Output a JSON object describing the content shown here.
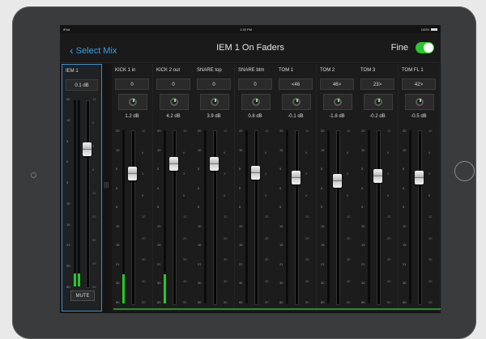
{
  "statusbar": {
    "left": "iPad",
    "time": "1:15 PM",
    "right": "100%"
  },
  "nav": {
    "back_label": "Select Mix",
    "title": "IEM 1 On Faders",
    "fine_label": "Fine",
    "fine_on": true
  },
  "scale_left": [
    "20",
    "10",
    "5",
    "0",
    "5",
    "10",
    "15",
    "21",
    "30",
    "60"
  ],
  "scale_right": [
    "12",
    "6",
    "3",
    "6",
    "12",
    "20",
    "30",
    "40",
    "50"
  ],
  "main_strip": {
    "name": "IEM 1",
    "level": "0.1 dB",
    "mute_label": "MUTE",
    "meter_level": 0.07
  },
  "channels": [
    {
      "name": "KICK 1 in",
      "pan": "0",
      "gain": "1.2 dB",
      "meter_level": 0.17
    },
    {
      "name": "KICK 2 out",
      "pan": "0",
      "gain": "4.2 dB",
      "meter_level": 0.17
    },
    {
      "name": "SNARE top",
      "pan": "0",
      "gain": "3.9 dB",
      "meter_level": 0
    },
    {
      "name": "SNARE btm",
      "pan": "0",
      "gain": "0.8 dB",
      "meter_level": 0
    },
    {
      "name": "TOM 1",
      "pan": "<46",
      "gain": "-0.1 dB",
      "meter_level": 0
    },
    {
      "name": "TOM 2",
      "pan": "46>",
      "gain": "-1.8 dB",
      "meter_level": 0
    },
    {
      "name": "TOM 3",
      "pan": "23>",
      "gain": "-0.2 dB",
      "meter_level": 0
    },
    {
      "name": "TOM FL 1",
      "pan": "42>",
      "gain": "-0.5 dB",
      "meter_level": 0
    }
  ]
}
